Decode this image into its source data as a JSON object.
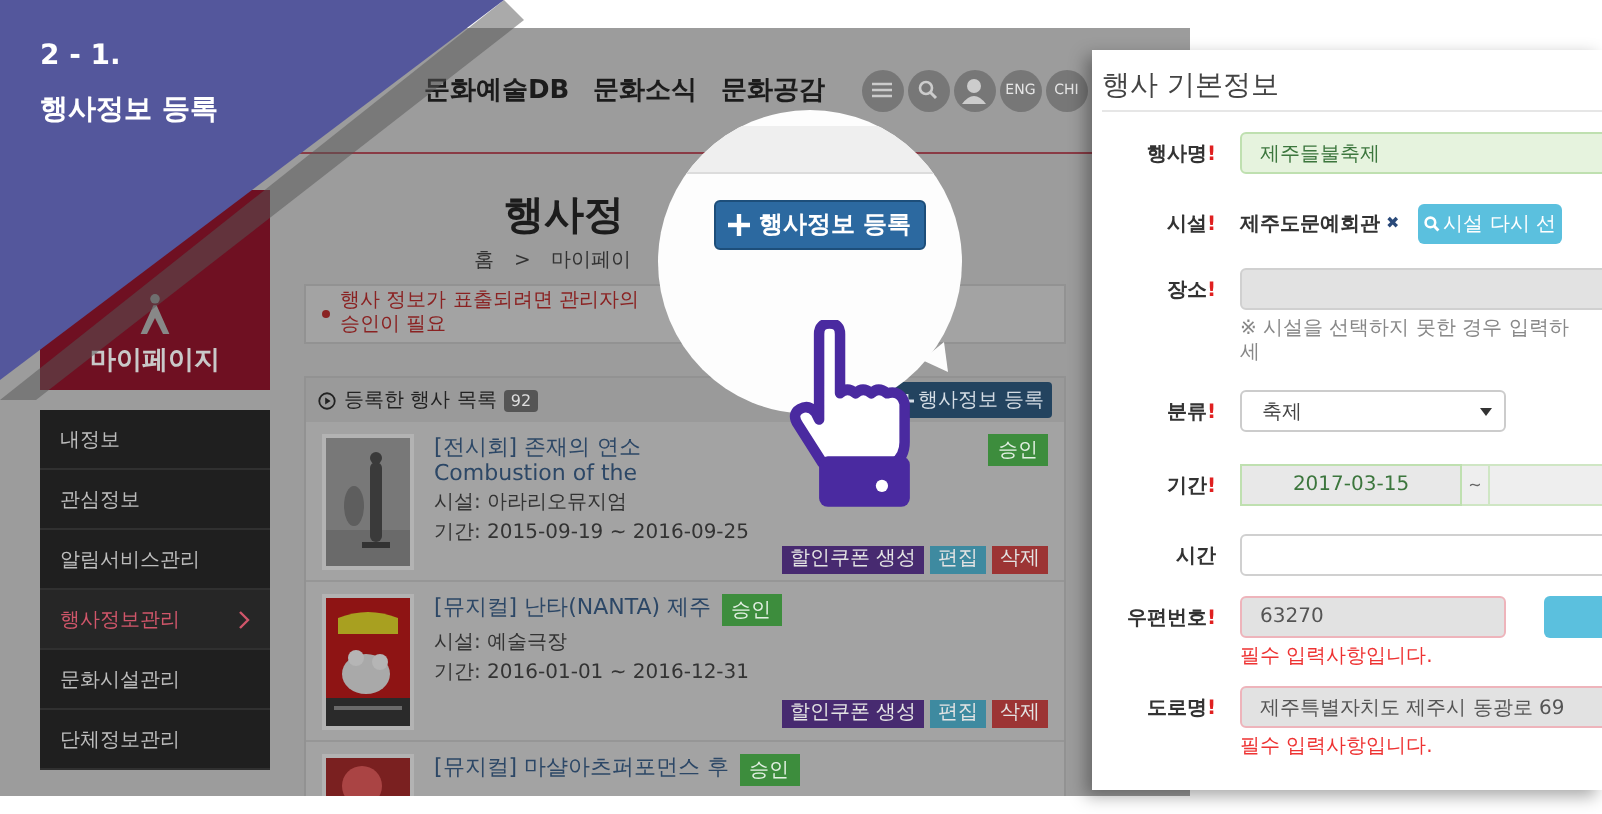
{
  "banner": {
    "step": "2 - 1.",
    "title": "행사정보 등록"
  },
  "site": {
    "nav": [
      "문화예술DB",
      "문화소식",
      "문화공감"
    ],
    "lang_buttons": [
      "ENG",
      "CHI"
    ],
    "sidebar": {
      "title": "마이페이지",
      "items": [
        {
          "label": "내정보",
          "selected": false
        },
        {
          "label": "관심정보",
          "selected": false
        },
        {
          "label": "알림서비스관리",
          "selected": false
        },
        {
          "label": "행사정보관리",
          "selected": true
        },
        {
          "label": "문화시설관리",
          "selected": false
        },
        {
          "label": "단체정보관리",
          "selected": false
        }
      ]
    },
    "page_title": "행사정",
    "breadcrumb": [
      "홈",
      ">",
      "마이페이"
    ],
    "notice": "행사 정보가 표출되려면 관리자의 승인이 필요",
    "list": {
      "title": "등록한 행사 목록",
      "count": "92",
      "add_button": "행사정보 등록",
      "events": [
        {
          "title": "[전시회] 존재의 연소 Combustion of the",
          "status": "승인",
          "facility": "시설: 아라리오뮤지엄",
          "period": "기간: 2015-09-19 ~ 2016-09-25",
          "actions": [
            {
              "kind": "coupon",
              "label": "할인쿠폰 생성"
            },
            {
              "kind": "edit",
              "label": "편집"
            },
            {
              "kind": "delete",
              "label": "삭제"
            }
          ]
        },
        {
          "title": "[뮤지컬] 난타(NANTA) 제주",
          "status": "승인",
          "facility": "시설: 예술극장",
          "period": "기간: 2016-01-01 ~ 2016-12-31",
          "actions": [
            {
              "kind": "coupon",
              "label": "할인쿠폰 생성"
            },
            {
              "kind": "edit",
              "label": "편집"
            },
            {
              "kind": "delete",
              "label": "삭제"
            }
          ]
        },
        {
          "title": "[뮤지컬] 마샬아츠퍼포먼스 후",
          "status": "승인"
        }
      ]
    }
  },
  "magnifier": {
    "button": "행사정보 등록"
  },
  "form": {
    "title": "행사 기본정보",
    "fields": [
      {
        "kind": "text",
        "label": "행사명",
        "required_mark": "!",
        "value": "제주들불축제",
        "valid": true,
        "invalid": false,
        "disabled": false
      },
      {
        "kind": "facility",
        "label": "시설",
        "required_mark": "!",
        "value": "제주도문예회관",
        "remove": "✖",
        "button": "시설 다시 선"
      },
      {
        "kind": "text",
        "label": "장소",
        "required_mark": "!",
        "valid": false,
        "invalid": false,
        "disabled": true,
        "note": "※ 시설을 선택하지 못한 경우 입력하세"
      },
      {
        "kind": "select",
        "label": "분류",
        "required_mark": "!",
        "value": "축제"
      },
      {
        "kind": "date_range",
        "label": "기간",
        "required_mark": "!",
        "start": "2017-03-15",
        "separator": "~",
        "valid": true,
        "invalid": false,
        "disabled": true
      },
      {
        "kind": "text",
        "label": "시간",
        "valid": false,
        "invalid": false,
        "disabled": false
      },
      {
        "kind": "zip",
        "label": "우편번호",
        "required_mark": "!",
        "value": "63270",
        "valid": false,
        "invalid": true,
        "disabled": true,
        "error": "필수 입력사항입니다."
      },
      {
        "kind": "text",
        "label": "도로명",
        "required_mark": "!",
        "value": "제주특별자치도 제주시 동광로 69",
        "valid": false,
        "invalid": true,
        "disabled": true,
        "error": "필수 입력사항입니다."
      }
    ]
  }
}
